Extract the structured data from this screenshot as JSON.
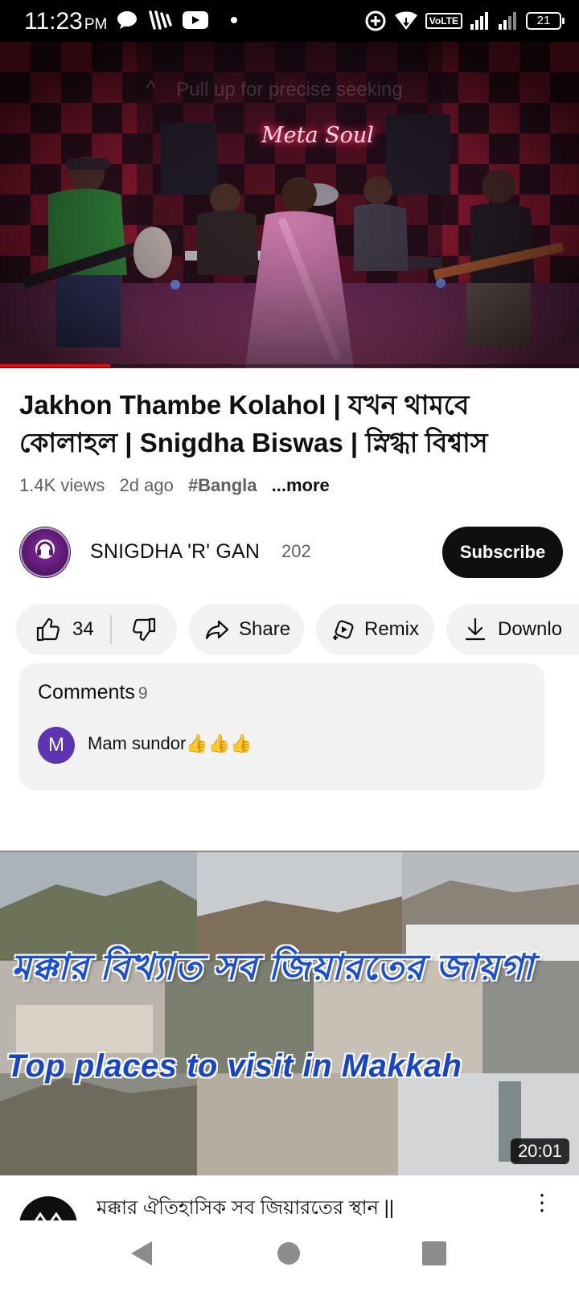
{
  "status_bar": {
    "time": "11:23",
    "ampm": "PM",
    "network_label": "VoLTE",
    "battery": "21"
  },
  "player": {
    "seek_hint": "Pull up for precise seeking",
    "stage_sign": "Meta Soul",
    "progress": 0.19,
    "accent_color": "#ff0000"
  },
  "video": {
    "title": "Jakhon Thambe Kolahol | যখন থামবে কোলাহল | Snigdha Biswas | স্নিগ্ধা বিশ্বাস",
    "views": "1.4K views",
    "age": "2d ago",
    "hashtag": "#Bangla",
    "more": "...more"
  },
  "channel": {
    "name": "SNIGDHA 'R' GAN",
    "subscribers": "202",
    "subscribe_label": "Subscribe"
  },
  "actions": {
    "like_count": "34",
    "share_label": "Share",
    "remix_label": "Remix",
    "download_label": "Downlo"
  },
  "comments": {
    "heading": "Comments",
    "count": "9",
    "avatar_letter": "M",
    "avatar_color": "#5e35b1",
    "top_comment": "Mam  sundor👍👍👍"
  },
  "next_video": {
    "thumb_text_bn": "মক্কার বিখ্যাত সব জিয়ারতের জায়গা",
    "thumb_text_en": "Top places to visit in Makkah",
    "duration": "20:01",
    "title": "মক্কার ঐতিহাসিক সব জিয়ারতের স্থান ||"
  },
  "icons": {
    "like": "thumbs-up-icon",
    "dislike": "thumbs-down-icon",
    "share": "share-arrow-icon",
    "remix": "remix-icon",
    "download": "download-icon",
    "more": "kebab-menu-icon"
  }
}
